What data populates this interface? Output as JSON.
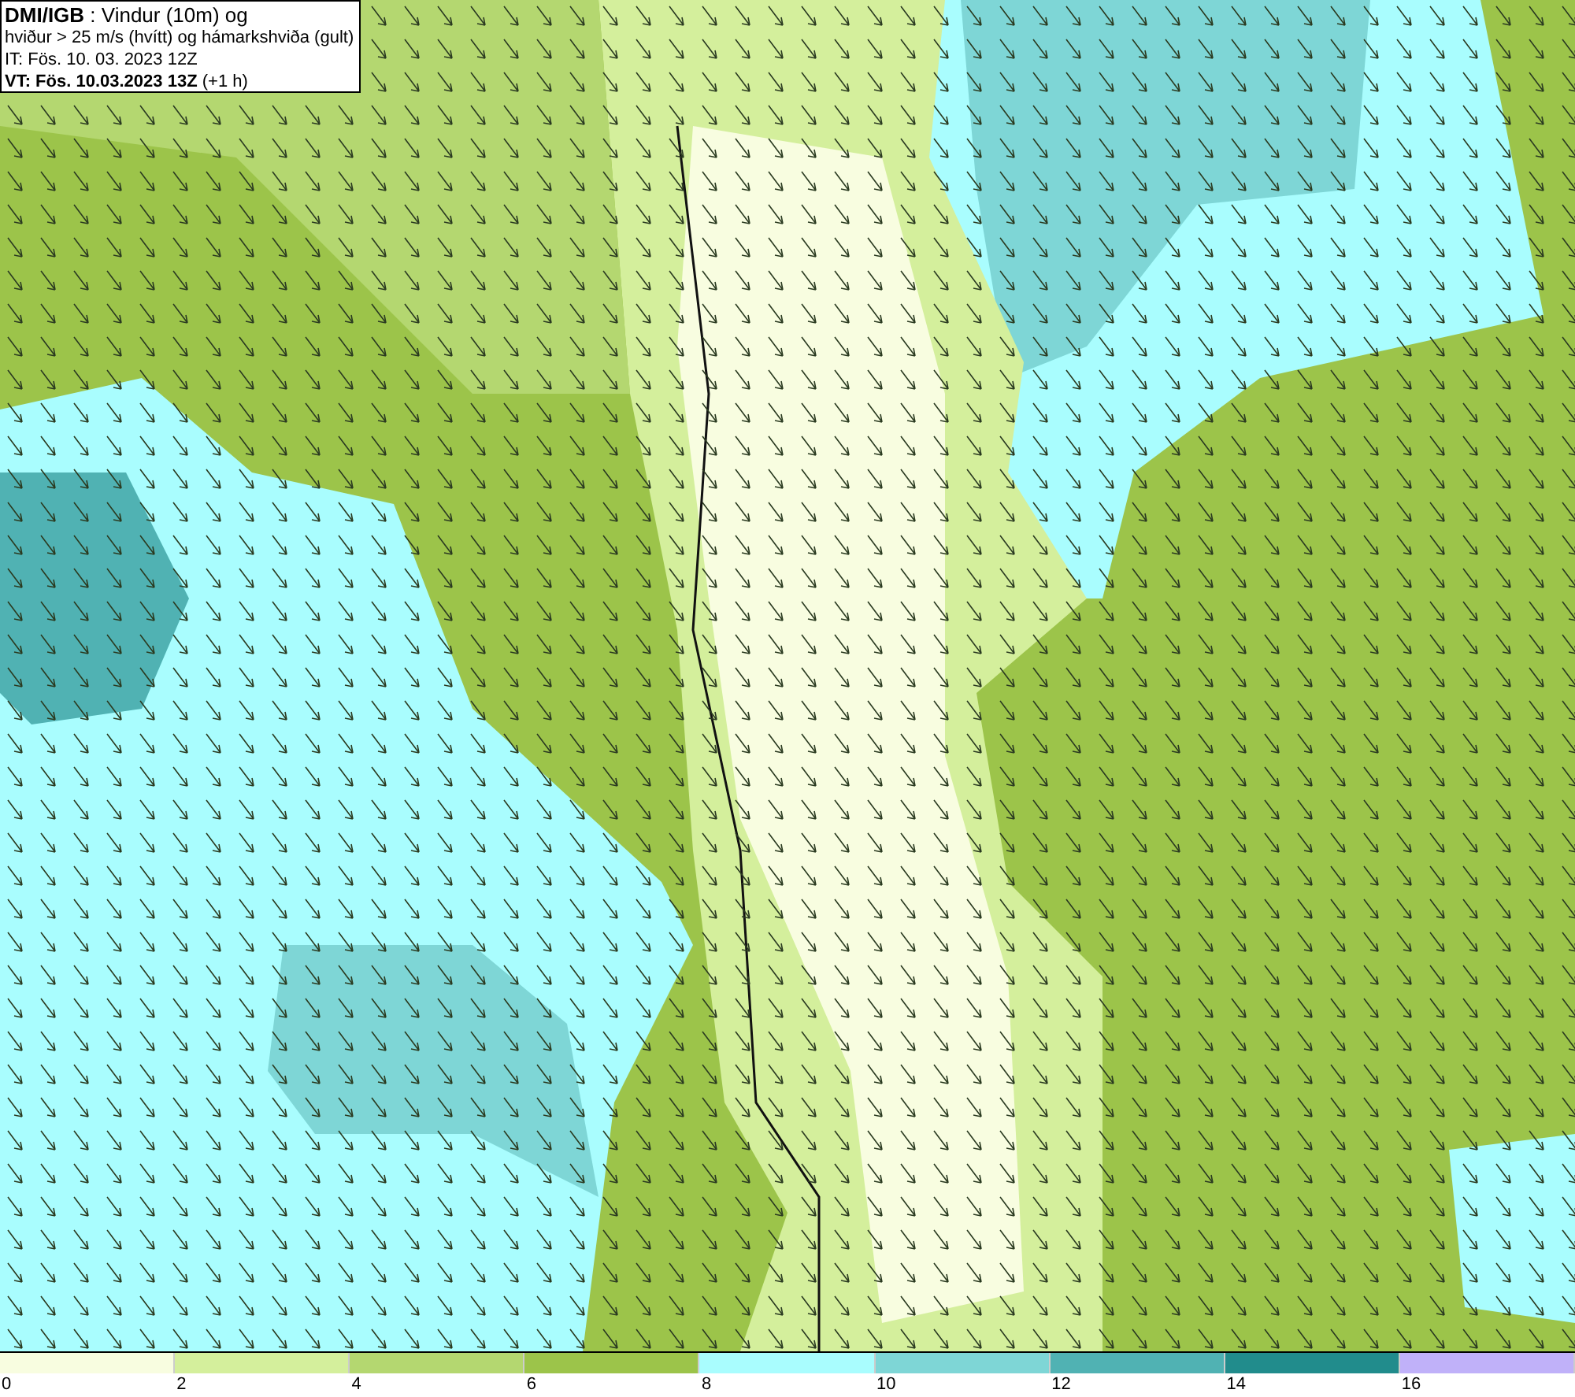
{
  "title_box": {
    "lines": [
      "**DMI/IGB** : Vindur (10m) og",
      "hviður > 25 m/s (hvítt) og hámarkshviða (gult)",
      "IT: Fös. 10. 03. 2023 12Z",
      "**VT: Fös. 10.03.2023 13Z** (+1 h)"
    ]
  },
  "legend": {
    "segments": [
      {
        "color": "#f8fde0"
      },
      {
        "color": "#d4ef9c"
      },
      {
        "color": "#b4d770"
      },
      {
        "color": "#9cc44a"
      },
      {
        "color": "#a9fdfe"
      },
      {
        "color": "#7ed6d6"
      },
      {
        "color": "#50b2b3"
      },
      {
        "color": "#218c8c"
      },
      {
        "color": "#c0b1f9"
      }
    ],
    "labels": [
      "0",
      "2",
      "4",
      "6",
      "8",
      "10",
      "12",
      "14",
      "16"
    ]
  }
}
